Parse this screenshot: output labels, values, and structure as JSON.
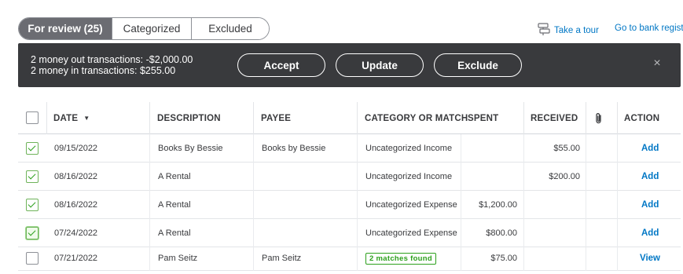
{
  "tabs": [
    {
      "label": "For review (25)",
      "active": true
    },
    {
      "label": "Categorized",
      "active": false
    },
    {
      "label": "Excluded",
      "active": false
    }
  ],
  "links": {
    "tour": "Take a tour",
    "bank_register": "Go to bank regist"
  },
  "batch": {
    "line1": "2 money out transactions: -$2,000.00",
    "line2": "2 money in transactions: $255.00",
    "accept": "Accept",
    "update": "Update",
    "exclude": "Exclude",
    "close_icon": "close-icon"
  },
  "table": {
    "headers": {
      "date": "DATE",
      "description": "DESCRIPTION",
      "payee": "PAYEE",
      "category": "CATEGORY OR MATCH",
      "spent": "SPENT",
      "received": "RECEIVED",
      "attachment_icon": "paperclip-icon",
      "action": "ACTION"
    },
    "rows": [
      {
        "checked": true,
        "date": "09/15/2022",
        "description": "Books By Bessie",
        "payee": "Books by Bessie",
        "category": "Uncategorized Income",
        "spent": "",
        "received": "$55.00",
        "action": "Add"
      },
      {
        "checked": true,
        "date": "08/16/2022",
        "description": "A Rental",
        "payee": "",
        "category": "Uncategorized Income",
        "spent": "",
        "received": "$200.00",
        "action": "Add"
      },
      {
        "checked": true,
        "date": "08/16/2022",
        "description": "A Rental",
        "payee": "",
        "category": "Uncategorized Expense",
        "spent": "$1,200.00",
        "received": "",
        "action": "Add"
      },
      {
        "checked": true,
        "date": "07/24/2022",
        "description": "A Rental",
        "payee": "",
        "category": "Uncategorized Expense",
        "spent": "$800.00",
        "received": "",
        "action": "Add"
      },
      {
        "checked": false,
        "date": "07/21/2022",
        "description": "Pam Seitz",
        "payee": "Pam Seitz",
        "category": "2 matches found",
        "spent": "$75.00",
        "received": "",
        "action": "View"
      }
    ]
  },
  "colors": {
    "accent_blue": "#0077c5",
    "batch_bar": "#393a3d",
    "active_tab": "#6b6c72",
    "match_green": "#2ca01c"
  }
}
